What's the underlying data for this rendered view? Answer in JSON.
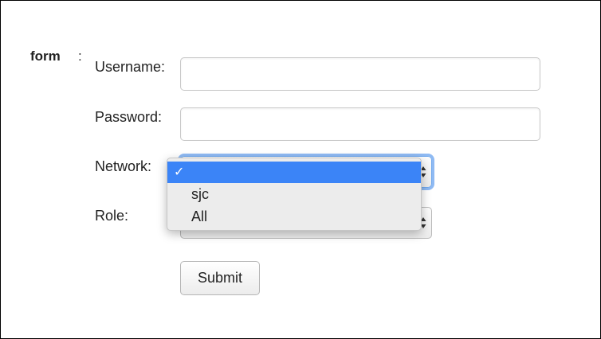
{
  "form": {
    "name": "form",
    "separator": ":",
    "username": {
      "label": "Username:",
      "value": "",
      "placeholder": ""
    },
    "password": {
      "label": "Password:",
      "value": "",
      "placeholder": ""
    },
    "network": {
      "label": "Network:",
      "selected_value": "",
      "options": [
        {
          "label": "",
          "selected": true
        },
        {
          "label": "sjc",
          "selected": false
        },
        {
          "label": "All",
          "selected": false
        }
      ]
    },
    "role": {
      "label": "Role:",
      "selected_value": ""
    },
    "submit_label": "Submit"
  },
  "colors": {
    "selection_highlight": "#3b84f7",
    "focus_ring": "#8fbaf3",
    "input_border": "#c8c8c8",
    "text": "#222222"
  },
  "icons": {
    "selected_option": "checkmark-icon",
    "select_indicator": "updown-arrows-icon"
  }
}
